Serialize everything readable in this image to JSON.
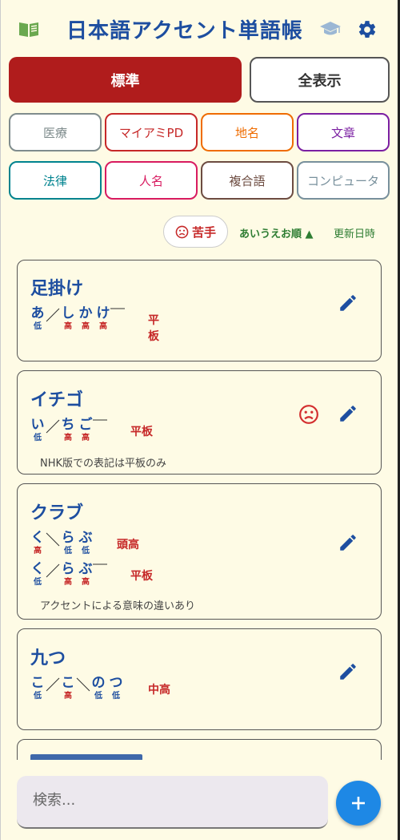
{
  "header": {
    "title": "日本語アクセント単語帳",
    "icons": [
      "book-icon",
      "graduation-cap-icon",
      "gear-icon"
    ]
  },
  "modes": {
    "standard": "標準",
    "show_all": "全表示"
  },
  "categories": [
    {
      "label": "医療",
      "color": "#7f8c8d"
    },
    {
      "label": "マイアミPD",
      "color": "#c62828"
    },
    {
      "label": "地名",
      "color": "#ef6c00"
    },
    {
      "label": "文章",
      "color": "#7b1fa2"
    },
    {
      "label": "法律",
      "color": "#00838f"
    },
    {
      "label": "人名",
      "color": "#d81b60"
    },
    {
      "label": "複合語",
      "color": "#6d4c41"
    },
    {
      "label": "コンピュータ",
      "color": "#78909c"
    }
  ],
  "filters": {
    "weak": "苦手",
    "sort_kana": "あいうえお順 ▲",
    "sort_updated": "更新日時"
  },
  "cards": [
    {
      "title": "足掛け",
      "readings": [
        {
          "mora": [
            {
              "k": "あ",
              "p": "低"
            },
            {
              "k": "し",
              "p": "高"
            },
            {
              "k": "か",
              "p": "高"
            },
            {
              "k": "け",
              "p": "高"
            }
          ],
          "pattern": "平板"
        }
      ],
      "note": ""
    },
    {
      "title": "イチゴ",
      "readings": [
        {
          "mora": [
            {
              "k": "い",
              "p": "低"
            },
            {
              "k": "ち",
              "p": "高"
            },
            {
              "k": "ご",
              "p": "高"
            }
          ],
          "pattern": "平板"
        }
      ],
      "note": "NHK版での表記は平板のみ"
    },
    {
      "title": "クラブ",
      "readings": [
        {
          "mora": [
            {
              "k": "く",
              "p": "高"
            },
            {
              "k": "ら",
              "p": "低"
            },
            {
              "k": "ぶ",
              "p": "低"
            }
          ],
          "pattern": "頭高"
        },
        {
          "mora": [
            {
              "k": "く",
              "p": "低"
            },
            {
              "k": "ら",
              "p": "高"
            },
            {
              "k": "ぶ",
              "p": "高"
            }
          ],
          "pattern": "平板"
        }
      ],
      "note": "アクセントによる意味の違いあり"
    },
    {
      "title": "九つ",
      "readings": [
        {
          "mora": [
            {
              "k": "こ",
              "p": "低"
            },
            {
              "k": "こ",
              "p": "高"
            },
            {
              "k": "の",
              "p": "低"
            },
            {
              "k": "つ",
              "p": "低"
            }
          ],
          "pattern": "中高"
        }
      ],
      "note": ""
    }
  ],
  "search": {
    "placeholder": "検索..."
  },
  "fab": {
    "label": "+"
  },
  "colors": {
    "accent_blue": "#1d4ea0",
    "accent_red": "#c62828",
    "standard_btn": "#b01c1c",
    "fab": "#1e88e5",
    "bg": "#fefbe5"
  }
}
